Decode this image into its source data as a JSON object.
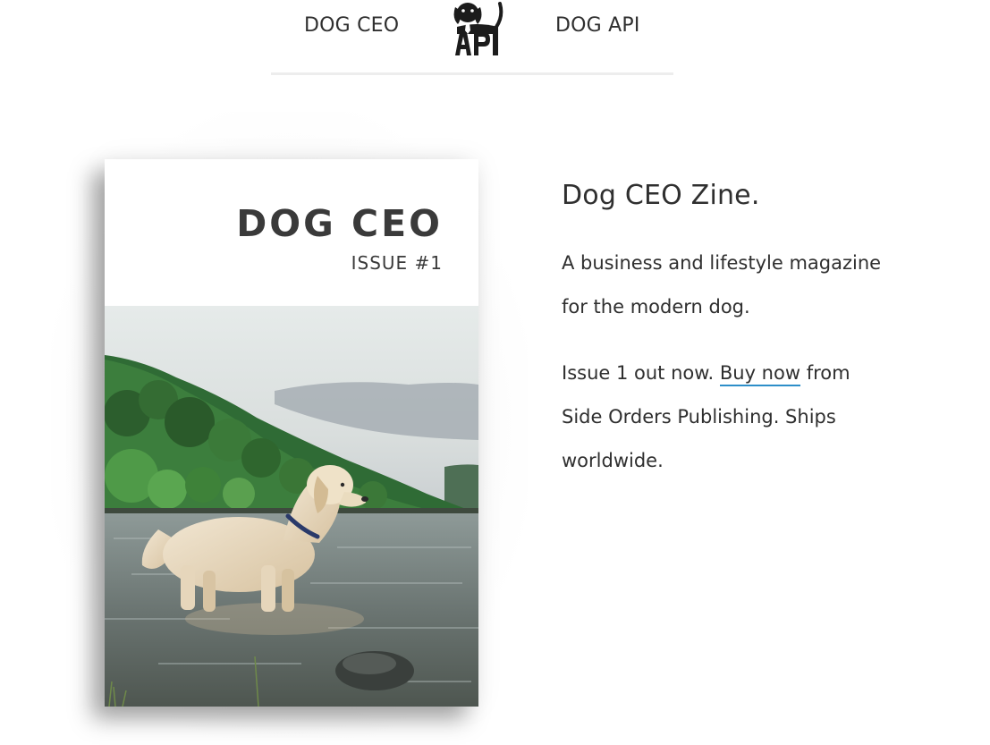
{
  "nav": {
    "left_link": "DOG CEO",
    "right_link": "DOG API",
    "logo_icon": "dog-api-logo-icon",
    "logo_text": "API"
  },
  "cover": {
    "title": "DOG CEO",
    "issue": "ISSUE #1",
    "photo_icon": "golden-retriever-in-lake-photo"
  },
  "info": {
    "title": "Dog CEO Zine.",
    "tagline": "A business and lifestyle magazine for the modern dog.",
    "issue_prefix": "Issue 1 out now.",
    "buy_link": "Buy now",
    "issue_suffix": "from Side Orders Publishing. Ships worldwide."
  },
  "colors": {
    "link_underline": "#2d8ec9",
    "text": "#2f2f2f",
    "divider": "#ededed"
  }
}
